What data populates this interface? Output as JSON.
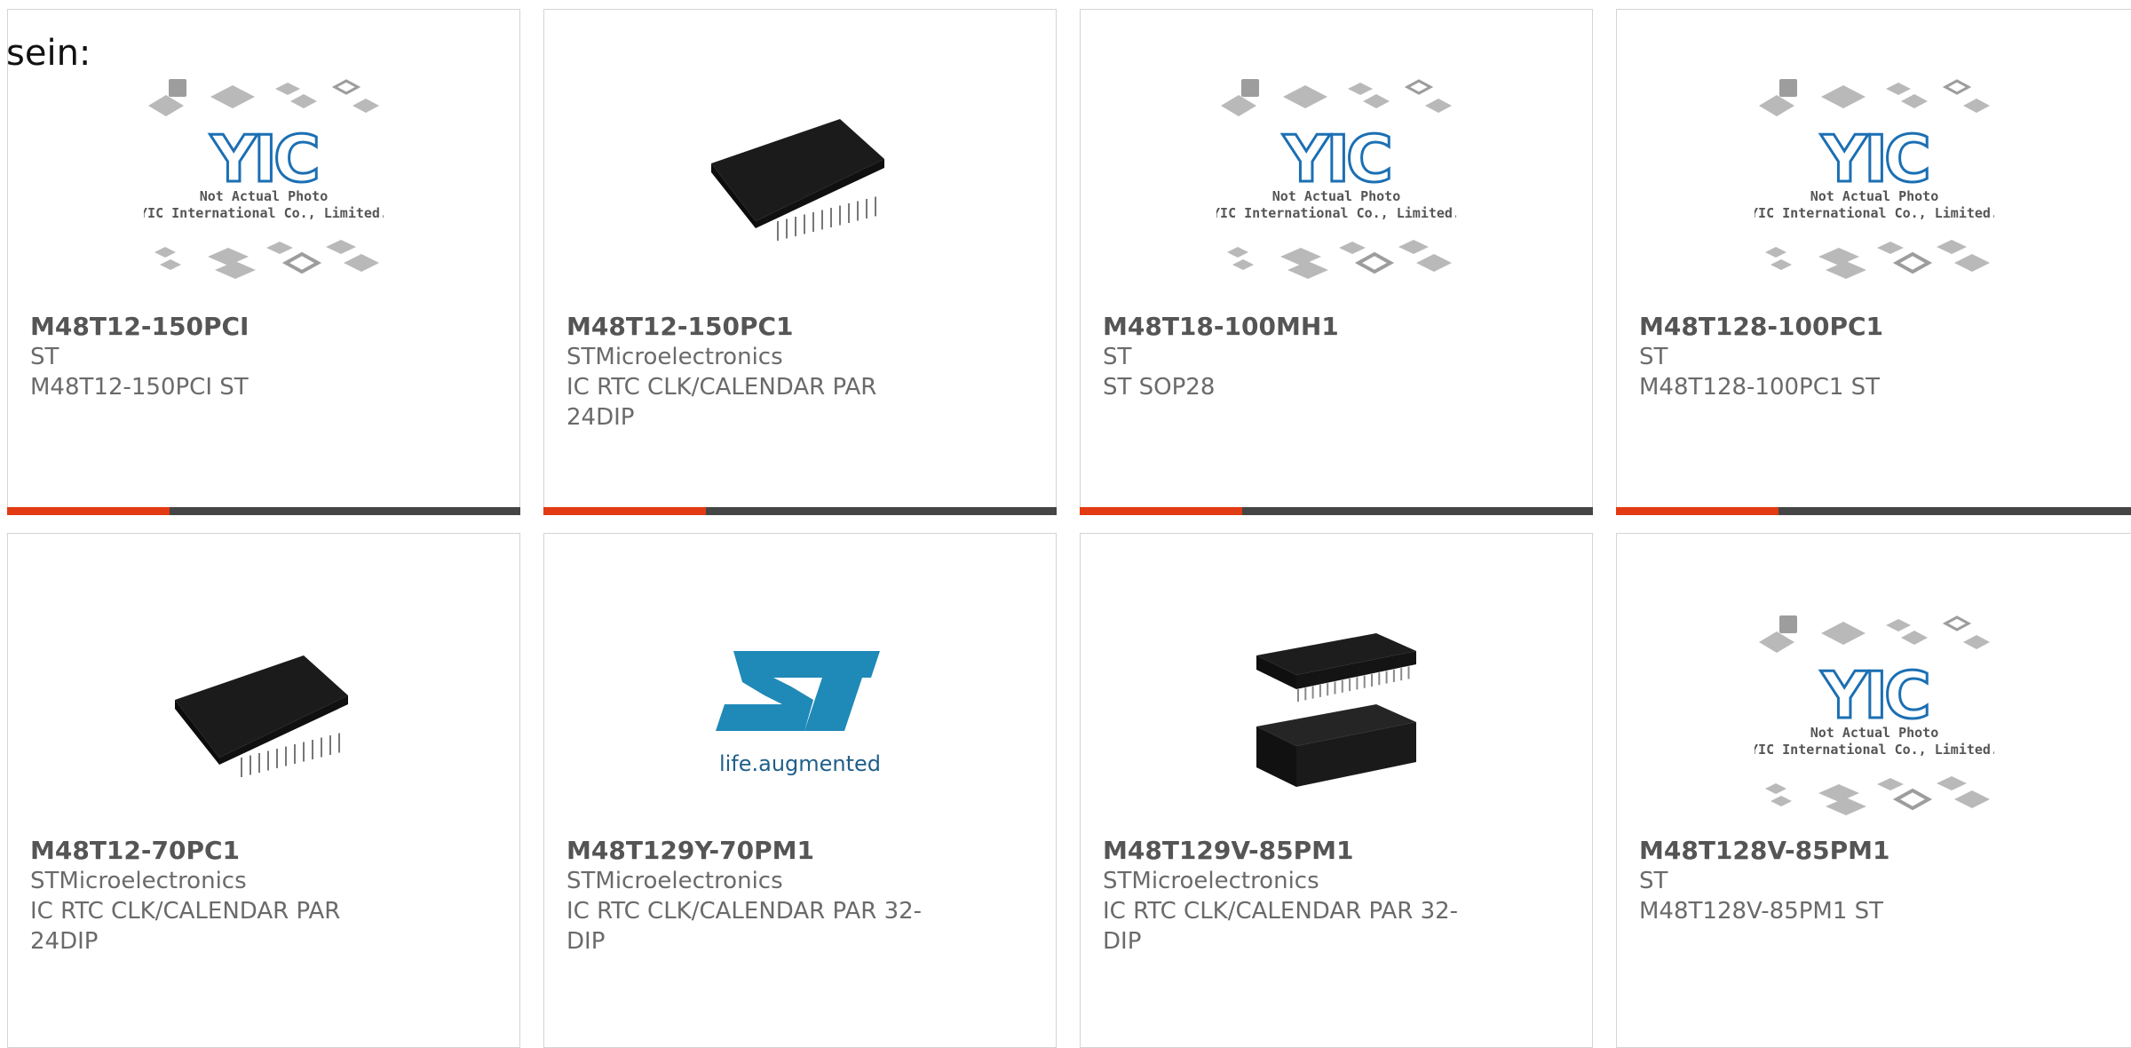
{
  "intro_text": "sein:",
  "colors": {
    "accent": "#e23b13",
    "bar": "#454545",
    "border": "#d4d4d4",
    "text": "#6a6a6a"
  },
  "placeholder": {
    "line1": "Not Actual Photo",
    "line2": "YIC International Co., Limited.",
    "logo": "YIC"
  },
  "products": [
    {
      "part": "M48T12-150PCI",
      "maker": "ST",
      "desc": "M48T12-150PCI ST",
      "image": "yic-placeholder"
    },
    {
      "part": "M48T12-150PC1",
      "maker": "STMicroelectronics",
      "desc": "IC RTC CLK/CALENDAR PAR 24DIP",
      "image": "dip-chip"
    },
    {
      "part": "M48T18-100MH1",
      "maker": "ST",
      "desc": "ST SOP28",
      "image": "yic-placeholder"
    },
    {
      "part": "M48T128-100PC1",
      "maker": "ST",
      "desc": "M48T128-100PC1 ST",
      "image": "yic-placeholder"
    },
    {
      "part": "M48T12-70PC1",
      "maker": "STMicroelectronics",
      "desc": "IC RTC CLK/CALENDAR PAR 24DIP",
      "image": "dip-chip"
    },
    {
      "part": "M48T129Y-70PM1",
      "maker": "STMicroelectronics",
      "desc": "IC RTC CLK/CALENDAR PAR 32-DIP",
      "image": "st-logo",
      "logo_tagline": "life.augmented"
    },
    {
      "part": "M48T129V-85PM1",
      "maker": "STMicroelectronics",
      "desc": "IC RTC CLK/CALENDAR PAR 32-DIP",
      "image": "dip-module"
    },
    {
      "part": "M48T128V-85PM1",
      "maker": "ST",
      "desc": "M48T128V-85PM1 ST",
      "image": "yic-placeholder"
    }
  ]
}
